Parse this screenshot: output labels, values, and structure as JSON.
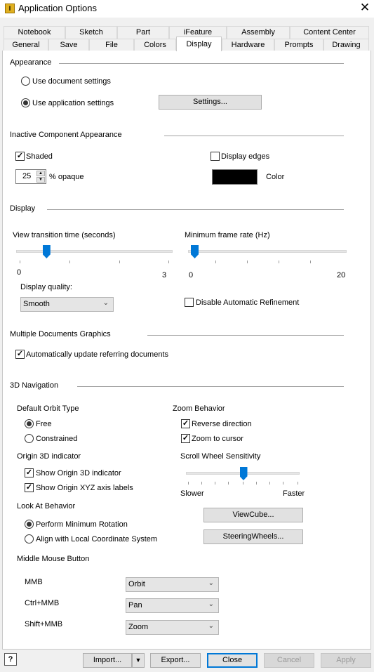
{
  "window": {
    "title": "Application Options",
    "icon_letter": "I",
    "close_glyph": "✕"
  },
  "tabs_row1": [
    "Notebook",
    "Sketch",
    "Part",
    "iFeature",
    "Assembly",
    "Content Center"
  ],
  "tabs_row2": [
    "General",
    "Save",
    "File",
    "Colors",
    "Display",
    "Hardware",
    "Prompts",
    "Drawing"
  ],
  "active_tab": "Display",
  "appearance": {
    "heading": "Appearance",
    "opt_doc": "Use document settings",
    "opt_app": "Use application settings",
    "selected": "app",
    "settings_btn": "Settings..."
  },
  "inactive": {
    "heading": "Inactive Component Appearance",
    "shaded_label": "Shaded",
    "shaded": true,
    "display_edges_label": "Display edges",
    "display_edges": false,
    "opacity_value": "25",
    "opacity_label": "% opaque",
    "color_label": "Color",
    "color_value": "#000000"
  },
  "display": {
    "heading": "Display",
    "view_transition_label": "View transition time (seconds)",
    "view_min": "0",
    "view_max": "3",
    "view_value": 0.5,
    "frame_rate_label": "Minimum frame rate (Hz)",
    "frame_min": "0",
    "frame_max": "20",
    "frame_value": 0,
    "quality_label": "Display quality:",
    "quality_value": "Smooth",
    "disable_refine_label": "Disable Automatic Refinement",
    "disable_refine": false
  },
  "multi": {
    "heading": "Multiple Documents Graphics",
    "auto_update_label": "Automatically update referring documents",
    "auto_update": true
  },
  "nav": {
    "heading": "3D Navigation",
    "orbit_label": "Default Orbit Type",
    "orbit_free": "Free",
    "orbit_constrained": "Constrained",
    "orbit_selected": "free",
    "zoom_label": "Zoom Behavior",
    "zoom_reverse_label": "Reverse direction",
    "zoom_reverse": true,
    "zoom_cursor_label": "Zoom to cursor",
    "zoom_cursor": true,
    "origin_label": "Origin 3D indicator",
    "show_origin_label": "Show Origin 3D indicator",
    "show_origin": true,
    "show_xyz_label": "Show Origin XYZ axis labels",
    "show_xyz": true,
    "scroll_label": "Scroll Wheel Sensitivity",
    "scroll_slower": "Slower",
    "scroll_faster": "Faster",
    "scroll_value": 0.5,
    "lookat_label": "Look At Behavior",
    "lookat_min": "Perform Minimum Rotation",
    "lookat_local": "Align with Local Coordinate System",
    "lookat_selected": "min",
    "viewcube_btn": "ViewCube...",
    "steering_btn": "SteeringWheels..."
  },
  "mouse": {
    "heading": "Middle Mouse Button",
    "rows": [
      {
        "label": "MMB",
        "value": "Orbit"
      },
      {
        "label": "Ctrl+MMB",
        "value": "Pan"
      },
      {
        "label": "Shift+MMB",
        "value": "Zoom"
      }
    ]
  },
  "footer": {
    "help_glyph": "?",
    "import_btn": "Import...",
    "export_btn": "Export...",
    "close_btn": "Close",
    "cancel_btn": "Cancel",
    "apply_btn": "Apply"
  }
}
